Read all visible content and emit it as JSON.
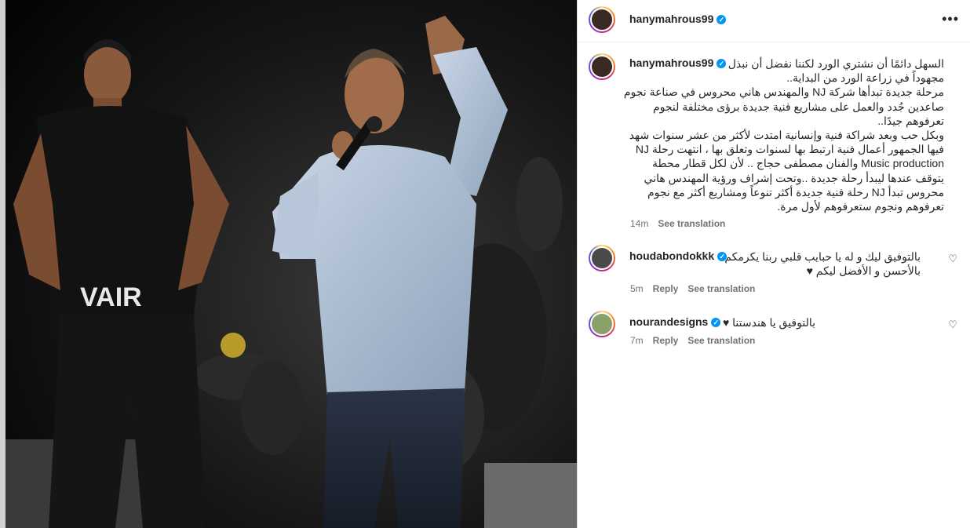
{
  "post": {
    "author": "hanymahrous99",
    "more_label": "•••",
    "caption": {
      "lines": [
        "السهل دائمًا أن نشتري الورد لكننا نفضل أن نبذل",
        "مجهوداً في زراعة الورد من البداية..",
        "مرحلة جديدة تبدأها شركة NJ والمهندس هاني محروس في صناعة نجوم",
        "صاعدين جُدد والعمل على مشاريع فنية جديدة برؤى مختلفة لنجوم",
        "تعرفوهم جيدًا..",
        "وبكل حب وبعد شراكة فنية وإنسانية امتدت لأكثر من عشر سنوات شهد",
        "فيها الجمهور أعمال فنية ارتبط بها لسنوات وتعلق بها ، انتهت رحلة NJ",
        "Music production والفنان مصطفى حجاج .. لأن لكل قطار محطة",
        "يتوقف عندها ليبدأ رحلة جديدة ..وتحت إشراف ورؤية المهندس هاني",
        "محروس تبدأ NJ رحلة فنية جديدة أكثر تنوعاً ومشاريع أكثر مع نجوم",
        "تعرفوهم ونجوم ستعرفوهم لأول مرة."
      ],
      "time": "14m",
      "see_translation": "See translation"
    }
  },
  "comments": [
    {
      "username": "houdabondokkk",
      "lines": [
        "بالتوفيق ليك و له يا حبايب قلبي ربنا يكرمكم",
        "بالأحسن و الأفضل ليكم ♥"
      ],
      "time": "5m",
      "reply": "Reply",
      "see_translation": "See translation"
    },
    {
      "username": "nourandesigns",
      "lines": [
        "بالتوفيق يا هندستنا ♥"
      ],
      "time": "7m",
      "reply": "Reply",
      "see_translation": "See translation"
    }
  ],
  "icons": {
    "verified": "✓",
    "heart": "♡"
  },
  "colors": {
    "verified": "#0095f6",
    "text": "#262626",
    "muted": "#737373"
  }
}
